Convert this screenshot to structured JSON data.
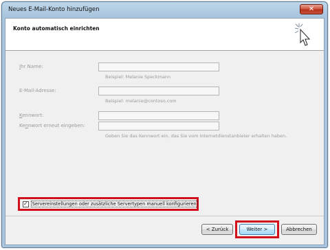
{
  "window": {
    "title": "Neues E-Mail-Konto hinzufügen",
    "close_glyph": "✕"
  },
  "header": {
    "title": "Konto automatisch einrichten",
    "icon": "wizard-cursor-icon"
  },
  "form": {
    "name_label": "Ihr Name:",
    "name_value": "",
    "name_hint": "Beispiel: Melanie Speckmann",
    "email_label": "E-Mail-Adresse:",
    "email_value": "",
    "email_hint": "Beispiel: melanie@contoso.com",
    "password_label": "Kennwort:",
    "password_value": "",
    "password_confirm_label": "Kennwort erneut eingeben:",
    "password_confirm_value": "",
    "password_hint": "Geben Sie das Kennwort ein, das Sie vom Internetdienstanbieter erhalten haben."
  },
  "manual_config": {
    "checked": true,
    "check_glyph": "✓",
    "label": "Servereinstellungen oder zusätzliche Servertypen manuell konfigurieren"
  },
  "buttons": {
    "back": "< Zurück",
    "next": "Weiter >",
    "cancel": "Abbrechen"
  },
  "colors": {
    "highlight": "#d1101c",
    "titlebar": "#a9c6de",
    "dialog_bg": "#f0f0f0"
  }
}
